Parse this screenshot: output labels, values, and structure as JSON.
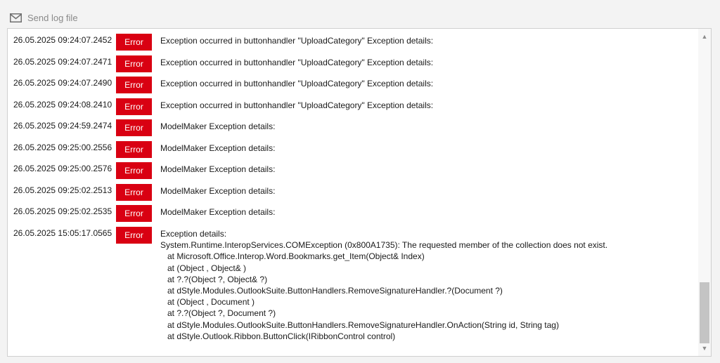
{
  "toolbar": {
    "send_log_label": "Send log file",
    "send_log_icon": "mail-icon"
  },
  "colors": {
    "error_badge": "#d90012",
    "scroll_thumb": "#c4c4c4"
  },
  "log": {
    "entries": [
      {
        "timestamp": "26.05.2025 09:24:07.2452",
        "level": "Error",
        "message": "Exception occurred in buttonhandler \"UploadCategory\" Exception details:"
      },
      {
        "timestamp": "26.05.2025 09:24:07.2471",
        "level": "Error",
        "message": "Exception occurred in buttonhandler \"UploadCategory\" Exception details:"
      },
      {
        "timestamp": "26.05.2025 09:24:07.2490",
        "level": "Error",
        "message": "Exception occurred in buttonhandler \"UploadCategory\" Exception details:"
      },
      {
        "timestamp": "26.05.2025 09:24:08.2410",
        "level": "Error",
        "message": "Exception occurred in buttonhandler \"UploadCategory\" Exception details:"
      },
      {
        "timestamp": "26.05.2025 09:24:59.2474",
        "level": "Error",
        "message": "ModelMaker Exception details:"
      },
      {
        "timestamp": "26.05.2025 09:25:00.2556",
        "level": "Error",
        "message": "ModelMaker Exception details:"
      },
      {
        "timestamp": "26.05.2025 09:25:00.2576",
        "level": "Error",
        "message": "ModelMaker Exception details:"
      },
      {
        "timestamp": "26.05.2025 09:25:02.2513",
        "level": "Error",
        "message": "ModelMaker Exception details:"
      },
      {
        "timestamp": "26.05.2025 09:25:02.2535",
        "level": "Error",
        "message": "ModelMaker Exception details:"
      },
      {
        "timestamp": "26.05.2025 15:05:17.0565",
        "level": "Error",
        "message": "Exception details:\nSystem.Runtime.InteropServices.COMException (0x800A1735): The requested member of the collection does not exist.\n   at Microsoft.Office.Interop.Word.Bookmarks.get_Item(Object& Index)\n   at (Object , Object& )\n   at ?.?(Object ?, Object& ?)\n   at dStyle.Modules.OutlookSuite.ButtonHandlers.RemoveSignatureHandler.?(Document ?)\n   at (Object , Document )\n   at ?.?(Object ?, Document ?)\n   at dStyle.Modules.OutlookSuite.ButtonHandlers.RemoveSignatureHandler.OnAction(String id, String tag)\n   at dStyle.Outlook.Ribbon.ButtonClick(IRibbonControl control)"
      }
    ]
  },
  "scrollbar": {
    "up_glyph": "▲",
    "down_glyph": "▼"
  }
}
